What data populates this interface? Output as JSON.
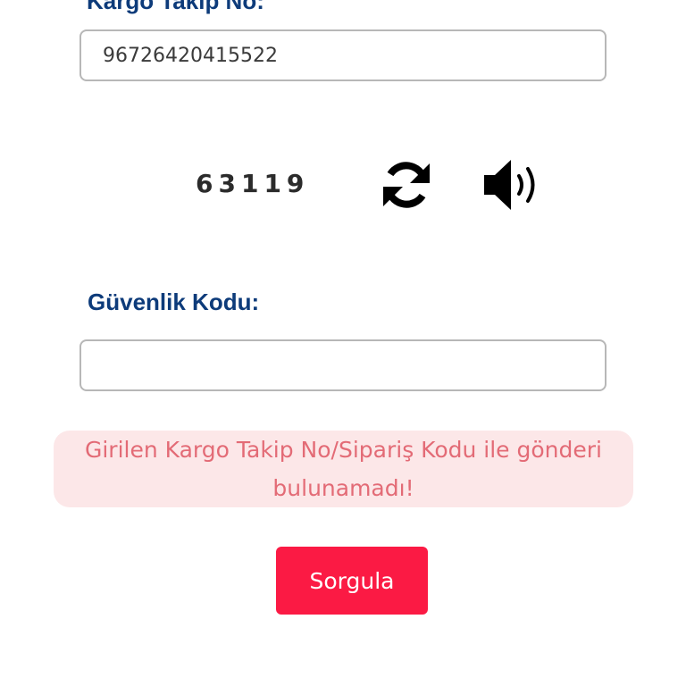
{
  "form": {
    "tracking_label": "Kargo Takip No:",
    "tracking_value": "96726420415522",
    "captcha_code": "63119",
    "security_label": "Güvenlik Kodu:",
    "security_value": "",
    "refresh_icon": "refresh-icon",
    "speaker_icon": "speaker-icon"
  },
  "alert": {
    "message": "Girilen Kargo Takip No/Sipariş Kodu ile gönderi bulunamadı!",
    "background": "#fce7e8",
    "text_color": "#e36b76"
  },
  "actions": {
    "submit_label": "Sorgula",
    "submit_color": "#fb1a44"
  }
}
